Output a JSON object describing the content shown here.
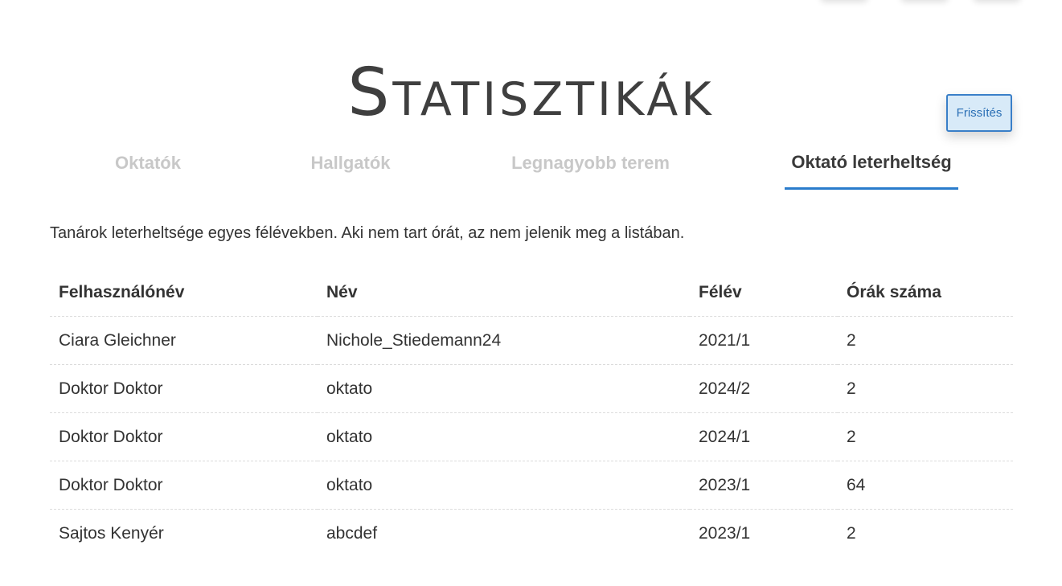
{
  "page": {
    "title": "Statisztikák",
    "refresh_label": "Frissítés"
  },
  "tabs": [
    {
      "label": "Oktatók",
      "active": false
    },
    {
      "label": "Hallgatók",
      "active": false
    },
    {
      "label": "Legnagyobb terem",
      "active": false
    },
    {
      "label": "Oktató leterheltség",
      "active": true
    }
  ],
  "content": {
    "description": "Tanárok leterheltsége egyes félévekben. Aki nem tart órát, az nem jelenik meg a listában."
  },
  "table": {
    "headers": [
      "Felhasználónév",
      "Név",
      "Félév",
      "Órák száma"
    ],
    "rows": [
      [
        "Ciara Gleichner",
        "Nichole_Stiedemann24",
        "2021/1",
        "2"
      ],
      [
        "Doktor Doktor",
        "oktato",
        "2024/2",
        "2"
      ],
      [
        "Doktor Doktor",
        "oktato",
        "2024/1",
        "2"
      ],
      [
        "Doktor Doktor",
        "oktato",
        "2023/1",
        "64"
      ],
      [
        "Sajtos Kenyér",
        "abcdef",
        "2023/1",
        "2"
      ]
    ]
  },
  "colors": {
    "accent": "#2a7ccc",
    "button_bg": "#d8eaf8",
    "inactive_tab": "#c8c8c8",
    "text": "#333333"
  }
}
